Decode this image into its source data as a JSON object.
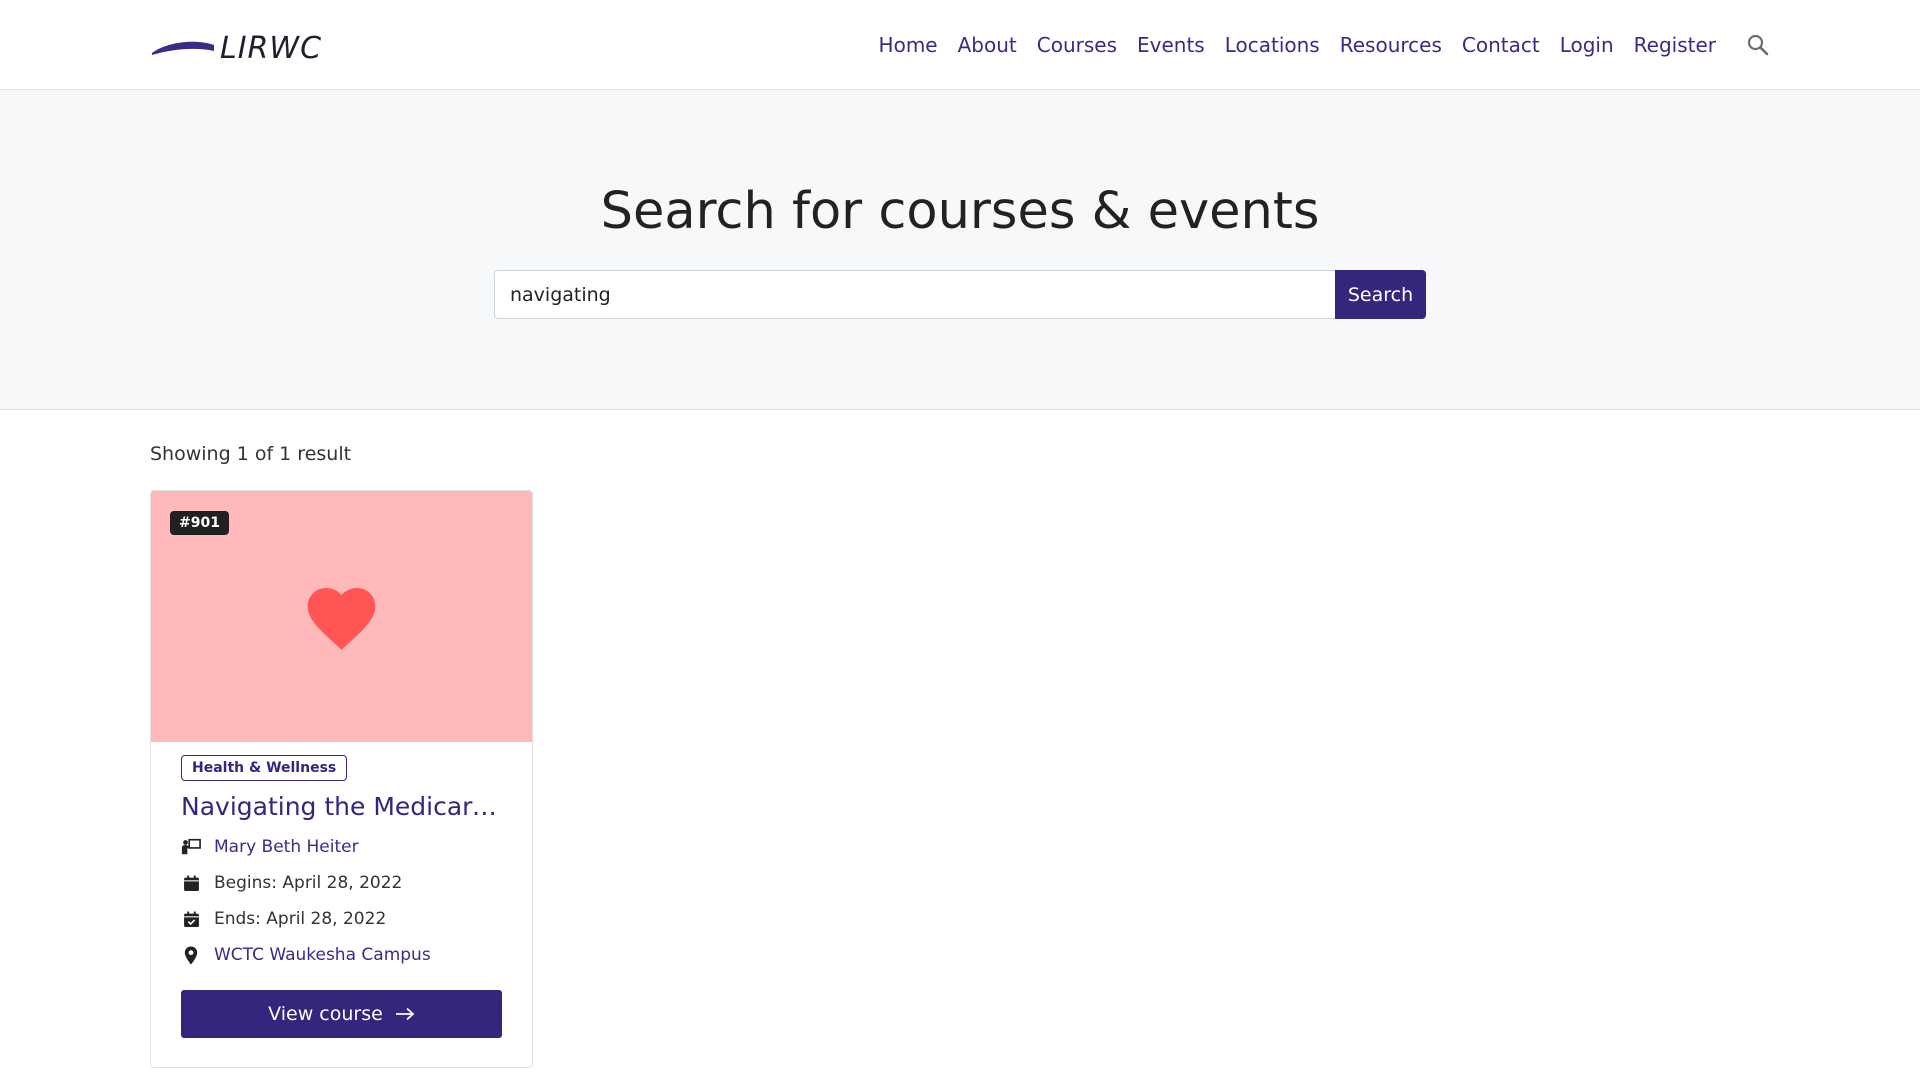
{
  "header": {
    "logo_text": "LIRWC",
    "nav": [
      "Home",
      "About",
      "Courses",
      "Events",
      "Locations",
      "Resources",
      "Contact",
      "Login",
      "Register"
    ],
    "search_icon": "search-icon"
  },
  "hero": {
    "title": "Search for courses & events",
    "search_value": "navigating",
    "search_button": "Search"
  },
  "results": {
    "count_text": "Showing 1 of 1 result",
    "cards": [
      {
        "badge": "#901",
        "image_icon": "heart-icon",
        "image_bg": "#ffb9ba",
        "heart_color": "#ff5555",
        "category": "Health & Wellness",
        "title": "Navigating the Medicare ...",
        "instructor": "Mary Beth Heiter",
        "begins": "Begins: April 28, 2022",
        "ends": "Ends: April 28, 2022",
        "location": "WCTC Waukesha Campus",
        "button": "View course"
      }
    ]
  },
  "colors": {
    "accent": "#33267d",
    "link": "#3a2b86",
    "hero_bg": "#f7f8f9"
  }
}
